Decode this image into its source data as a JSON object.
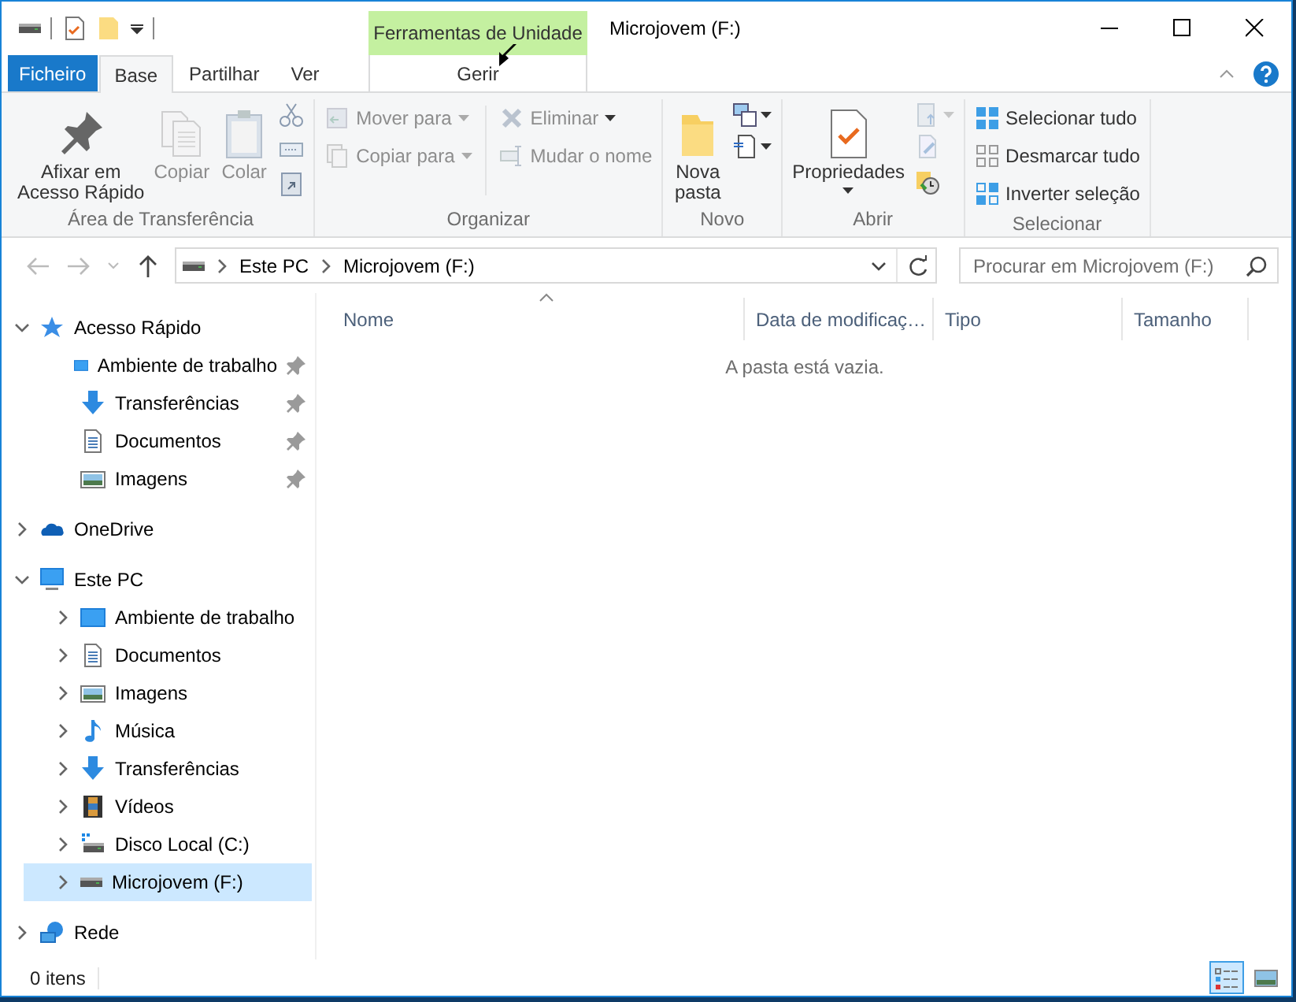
{
  "window": {
    "title": "Microjovem (F:)"
  },
  "context_tab": {
    "group": "Ferramentas de Unidade",
    "label": "Gerir"
  },
  "tabs": [
    {
      "label": "Ficheiro",
      "kind": "file",
      "selected": false
    },
    {
      "label": "Base",
      "kind": "tab",
      "selected": true
    },
    {
      "label": "Partilhar",
      "kind": "tab",
      "selected": false
    },
    {
      "label": "Ver",
      "kind": "tab",
      "selected": false
    }
  ],
  "ribbon_groups": [
    {
      "label": "Área de Transferência",
      "commands": [
        {
          "label": "Afixar em\nAcesso Rápido",
          "kind": "large",
          "disabled": false
        },
        {
          "label": "Copiar",
          "kind": "large",
          "disabled": true
        },
        {
          "label": "Colar",
          "kind": "large",
          "disabled": true
        },
        {
          "kind": "icons"
        }
      ]
    },
    {
      "label": "Organizar",
      "commands": [
        {
          "label": "Mover para",
          "kind": "small",
          "disabled": true,
          "dropdown": true
        },
        {
          "label": "Copiar para",
          "kind": "small",
          "disabled": true,
          "dropdown": true
        },
        {
          "label": "Eliminar",
          "kind": "small",
          "disabled": true,
          "dropdown": true
        },
        {
          "label": "Mudar o nome",
          "kind": "small",
          "disabled": true,
          "dropdown": false
        }
      ]
    },
    {
      "label": "Novo",
      "commands": [
        {
          "label": "Nova\npasta",
          "kind": "large",
          "disabled": false
        },
        {
          "kind": "icons"
        }
      ]
    },
    {
      "label": "Abrir",
      "commands": [
        {
          "label": "Propriedades",
          "kind": "large",
          "disabled": false,
          "dropdown": true
        },
        {
          "kind": "icons"
        }
      ]
    },
    {
      "label": "Selecionar",
      "commands": [
        {
          "label": "Selecionar tudo",
          "kind": "small",
          "disabled": false
        },
        {
          "label": "Desmarcar tudo",
          "kind": "small",
          "disabled": false
        },
        {
          "label": "Inverter seleção",
          "kind": "small",
          "disabled": false
        }
      ]
    }
  ],
  "address": {
    "crumbs": [
      "Este PC",
      "Microjovem (F:)"
    ]
  },
  "search": {
    "placeholder": "Procurar em Microjovem (F:)"
  },
  "navigation": [
    {
      "label": "Acesso Rápido",
      "kind": "star",
      "expanded": true,
      "selected": false,
      "children": [
        {
          "label": "Ambiente de trabalho",
          "kind": "desktop",
          "pinned": true,
          "selected": false
        },
        {
          "label": "Transferências",
          "kind": "downloads",
          "pinned": true,
          "selected": false
        },
        {
          "label": "Documentos",
          "kind": "documents",
          "pinned": true,
          "selected": false
        },
        {
          "label": "Imagens",
          "kind": "pictures",
          "pinned": true,
          "selected": false
        }
      ]
    },
    {
      "label": "OneDrive",
      "kind": "cloud",
      "expanded": false,
      "selected": false
    },
    {
      "label": "Este PC",
      "kind": "pc",
      "expanded": true,
      "selected": false,
      "children": [
        {
          "label": "Ambiente de trabalho",
          "kind": "desktop",
          "expanded": false,
          "selected": false
        },
        {
          "label": "Documentos",
          "kind": "documents",
          "expanded": false,
          "selected": false
        },
        {
          "label": "Imagens",
          "kind": "pictures",
          "expanded": false,
          "selected": false
        },
        {
          "label": "Música",
          "kind": "music",
          "expanded": false,
          "selected": false
        },
        {
          "label": "Transferências",
          "kind": "downloads",
          "expanded": false,
          "selected": false
        },
        {
          "label": "Vídeos",
          "kind": "videos",
          "expanded": false,
          "selected": false
        },
        {
          "label": "Disco Local (C:)",
          "kind": "system-drive",
          "expanded": false,
          "selected": false
        },
        {
          "label": "Microjovem (F:)",
          "kind": "drive",
          "expanded": false,
          "selected": true
        }
      ]
    },
    {
      "label": "Rede",
      "kind": "network",
      "expanded": false,
      "selected": false
    }
  ],
  "table": {
    "columns": [
      {
        "label": "Nome",
        "sorted": true
      },
      {
        "label": "Data de modificaç…",
        "sorted": false
      },
      {
        "label": "Tipo",
        "sorted": false
      },
      {
        "label": "Tamanho",
        "sorted": false
      }
    ],
    "empty_message": "A pasta está vazia."
  },
  "status_bar": {
    "count": "0 itens",
    "views": [
      {
        "kind": "details",
        "selected": true
      },
      {
        "kind": "large-icons",
        "selected": false
      }
    ]
  }
}
